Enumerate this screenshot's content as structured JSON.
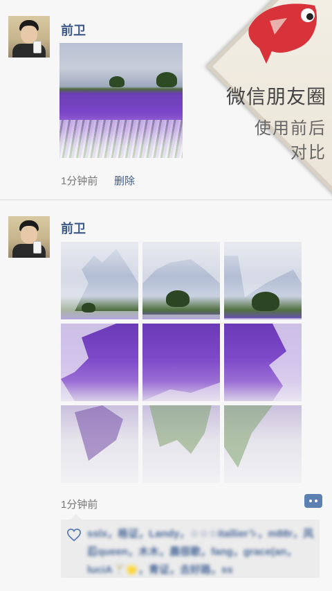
{
  "posts": [
    {
      "author": "前卫",
      "time": "1分钟前",
      "delete_label": "删除",
      "image_icon": "lavender-field-photo"
    },
    {
      "author": "前卫",
      "time": "1分钟前",
      "grid_tiles": 9,
      "likes_text": "sslx，格证，Landy，☆☆☆itallier♑，m88r，风忍queen，木木，晨很歌，fang，grace(an，luciA🍸🌟，青证，去好路，ss",
      "icons": {
        "heart": "heart-icon",
        "comment": "comment-icon"
      }
    }
  ],
  "promo": {
    "title": "微信朋友圈",
    "line2": "使用前后",
    "line3": "对比",
    "mascot": "red-fish-icon"
  },
  "colors": {
    "name": "#3d5a8a",
    "accent": "#5d80b3",
    "mascot": "#d8333a"
  }
}
